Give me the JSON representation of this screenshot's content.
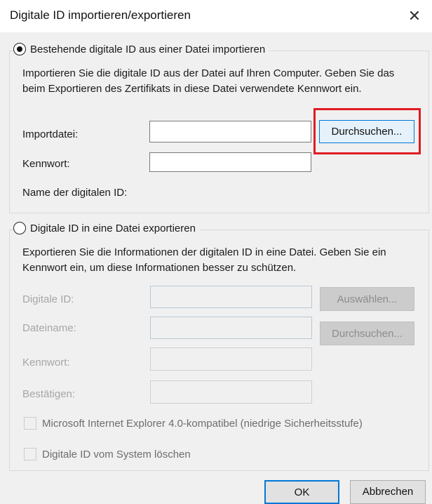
{
  "dialog": {
    "title": "Digitale ID importieren/exportieren",
    "close_glyph": "✕"
  },
  "import_section": {
    "radio_label": "Bestehende digitale ID aus einer Datei importieren",
    "selected": true,
    "description": "Importieren Sie die digitale ID aus der Datei auf Ihren Computer. Geben Sie das beim Exportieren des Zertifikats in diese Datei verwendete Kennwort ein.",
    "import_file_label": "Importdatei:",
    "import_file_value": "",
    "browse_button": "Durchsuchen...",
    "password_label": "Kennwort:",
    "password_value": "",
    "id_name_label": "Name der digitalen ID:"
  },
  "export_section": {
    "radio_label": "Digitale ID in eine Datei exportieren",
    "selected": false,
    "description": "Exportieren Sie die Informationen der digitalen ID in eine Datei. Geben Sie ein Kennwort ein, um diese Informationen besser zu schützen.",
    "digital_id_label": "Digitale ID:",
    "select_button": "Auswählen...",
    "filename_label": "Dateiname:",
    "browse_button": "Durchsuchen...",
    "password_label": "Kennwort:",
    "confirm_label": "Bestätigen:",
    "ie_compat_label": "Microsoft Internet Explorer 4.0-kompatibel (niedrige Sicherheitsstufe)",
    "delete_label": "Digitale ID vom System löschen"
  },
  "footer": {
    "ok_button": "OK",
    "cancel_button": "Abbrechen"
  },
  "colors": {
    "highlight": "#e01b24",
    "accent": "#0078d7"
  }
}
